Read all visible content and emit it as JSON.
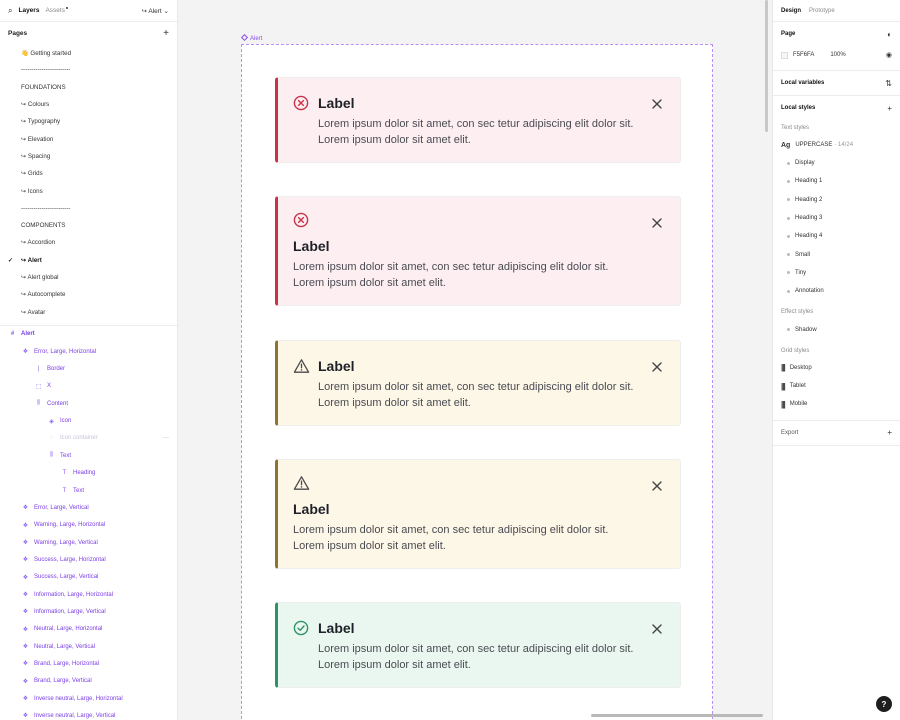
{
  "left": {
    "tabs": {
      "layers": "Layers",
      "assets": "Assets",
      "current_page": "↪ Alert ⌄"
    },
    "pages_title": "Pages",
    "pages": [
      {
        "label": "👋 Getting started"
      },
      {
        "label": "------------------------"
      },
      {
        "label": "FOUNDATIONS"
      },
      {
        "label": "↪ Colours"
      },
      {
        "label": "↪ Typography"
      },
      {
        "label": "↪ Elevation"
      },
      {
        "label": "↪ Spacing"
      },
      {
        "label": "↪ Grids"
      },
      {
        "label": "↪ Icons"
      },
      {
        "label": "------------------------"
      },
      {
        "label": "COMPONENTS"
      },
      {
        "label": "↪ Accordion"
      },
      {
        "label": "↪ Alert",
        "active": true
      },
      {
        "label": "↪ Alert global"
      },
      {
        "label": "↪ Autocomplete"
      },
      {
        "label": "↪ Avatar"
      }
    ],
    "layers_root": "Alert",
    "layers": [
      {
        "label": "Error, Large, Horizontal",
        "glyph": "❖",
        "indent": 1
      },
      {
        "label": "Border",
        "glyph": "|",
        "indent": 2
      },
      {
        "label": "X",
        "glyph": "⬚",
        "indent": 2
      },
      {
        "label": "Content",
        "glyph": "⫼",
        "indent": 2
      },
      {
        "label": "Icon",
        "glyph": "◈",
        "indent": 3
      },
      {
        "label": "Icon container",
        "glyph": "◌",
        "indent": 3,
        "muted": true
      },
      {
        "label": "Text",
        "glyph": "⫼",
        "indent": 3
      },
      {
        "label": "Heading",
        "glyph": "T",
        "indent": 4
      },
      {
        "label": "Text",
        "glyph": "T",
        "indent": 4
      },
      {
        "label": "Error, Large, Vertical",
        "glyph": "❖",
        "indent": 1
      },
      {
        "label": "Warning, Large, Horizontal",
        "glyph": "❖",
        "indent": 1
      },
      {
        "label": "Warning, Large, Vertical",
        "glyph": "❖",
        "indent": 1
      },
      {
        "label": "Success, Large, Horizontal",
        "glyph": "❖",
        "indent": 1
      },
      {
        "label": "Success, Large, Vertical",
        "glyph": "❖",
        "indent": 1
      },
      {
        "label": "Information, Large, Horizontal",
        "glyph": "❖",
        "indent": 1
      },
      {
        "label": "Information, Large, Vertical",
        "glyph": "❖",
        "indent": 1
      },
      {
        "label": "Neutral, Large, Horizontal",
        "glyph": "❖",
        "indent": 1
      },
      {
        "label": "Neutral, Large, Vertical",
        "glyph": "❖",
        "indent": 1
      },
      {
        "label": "Brand, Large, Horizontal",
        "glyph": "❖",
        "indent": 1
      },
      {
        "label": "Brand, Large, Vertical",
        "glyph": "❖",
        "indent": 1
      },
      {
        "label": "Inverse neutral, Large, Horizontal",
        "glyph": "❖",
        "indent": 1
      },
      {
        "label": "Inverse neutral, Large, Vertical",
        "glyph": "❖",
        "indent": 1
      }
    ]
  },
  "canvas": {
    "frame_label": "Alert",
    "alerts": [
      {
        "variant": "error",
        "layout": "horizontal",
        "label": "Label",
        "text": "Lorem ipsum dolor sit amet, con sec tetur adipiscing elit dolor sit. Lorem ipsum dolor sit amet elit.",
        "bg": "#fdeff1",
        "accent": "#c8334a",
        "icon": "x-circle"
      },
      {
        "variant": "error",
        "layout": "vertical",
        "label": "Label",
        "text": "Lorem ipsum dolor sit amet, con sec tetur adipiscing elit dolor sit. Lorem ipsum dolor sit amet elit.",
        "bg": "#fdeff1",
        "accent": "#c8334a",
        "icon": "x-circle"
      },
      {
        "variant": "warning",
        "layout": "horizontal",
        "label": "Label",
        "text": "Lorem ipsum dolor sit amet, con sec tetur adipiscing elit dolor sit. Lorem ipsum dolor sit amet elit.",
        "bg": "#fdf7e8",
        "accent": "#8e7333",
        "icon": "warning-triangle"
      },
      {
        "variant": "warning",
        "layout": "vertical",
        "label": "Label",
        "text": "Lorem ipsum dolor sit amet, con sec tetur adipiscing elit dolor sit. Lorem ipsum dolor sit amet elit.",
        "bg": "#fdf7e8",
        "accent": "#8e7333",
        "icon": "warning-triangle"
      },
      {
        "variant": "success",
        "layout": "horizontal",
        "label": "Label",
        "text": "Lorem ipsum dolor sit amet, con sec tetur adipiscing elit dolor sit. Lorem ipsum dolor sit amet elit.",
        "bg": "#eaf7f0",
        "accent": "#2f9266",
        "icon": "check-circle"
      }
    ]
  },
  "right": {
    "tabs": {
      "design": "Design",
      "prototype": "Prototype"
    },
    "page_title": "Page",
    "page_color": "F5F6FA",
    "page_opacity": "100%",
    "local_variables": "Local variables",
    "local_styles": "Local styles",
    "text_styles_title": "Text styles",
    "text_style_main": "UPPERCASE",
    "text_style_main_meta": "· 14/24",
    "ag": "Ag",
    "text_styles": [
      "Display",
      "Heading 1",
      "Heading 2",
      "Heading 3",
      "Heading 4",
      "Small",
      "Tiny",
      "Annotation"
    ],
    "effect_styles_title": "Effect styles",
    "effect_styles": [
      "Shadow"
    ],
    "grid_styles_title": "Grid styles",
    "grid_styles": [
      "Desktop",
      "Tablet",
      "Mobile"
    ],
    "export": "Export",
    "help": "?"
  }
}
